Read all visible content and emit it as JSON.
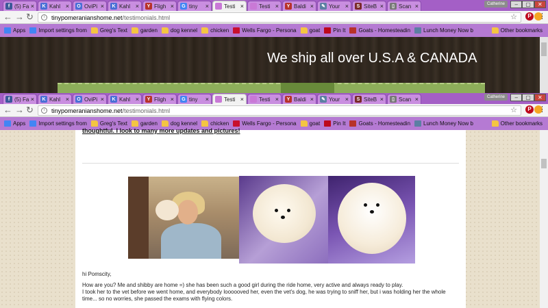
{
  "tabs": [
    {
      "title": "(5) Fa",
      "favicon_color": "#3b5998",
      "favicon_glyph": "f"
    },
    {
      "title": "Kahl",
      "favicon_color": "#4a6fd6",
      "favicon_glyph": "K"
    },
    {
      "title": "OviPi",
      "favicon_color": "#4a6fd6",
      "favicon_glyph": "O"
    },
    {
      "title": "Kahl",
      "favicon_color": "#4a6fd6",
      "favicon_glyph": "K"
    },
    {
      "title": "Fligh",
      "favicon_color": "#b7322a",
      "favicon_glyph": "Y"
    },
    {
      "title": "tiny",
      "favicon_color": "#4285f4",
      "favicon_glyph": "G"
    },
    {
      "title": "Testi",
      "favicon_color": "#c979d6",
      "favicon_glyph": ""
    },
    {
      "title": "Testi",
      "favicon_color": "#c979d6",
      "favicon_glyph": ""
    },
    {
      "title": "Baldi",
      "favicon_color": "#b7322a",
      "favicon_glyph": "Y"
    },
    {
      "title": "Your",
      "favicon_color": "#5c7fa3",
      "favicon_glyph": "✎"
    },
    {
      "title": "SiteB",
      "favicon_color": "#7a2a2a",
      "favicon_glyph": "S"
    },
    {
      "title": "Scan",
      "favicon_color": "#777777",
      "favicon_glyph": "▯"
    }
  ],
  "window_label": "Catherine",
  "address_bar": {
    "domain": "tinypomeranianshome.net",
    "path": "/testimonials.html"
  },
  "bookmarks": [
    {
      "label": "Apps",
      "icon": "apps-icon",
      "color": "#4285f4"
    },
    {
      "label": "Import settings from",
      "icon": "google-icon",
      "color": "#4285f4"
    },
    {
      "label": "Greg's Text",
      "icon": "folder-icon"
    },
    {
      "label": "garden",
      "icon": "folder-icon"
    },
    {
      "label": "dog kennel",
      "icon": "folder-icon"
    },
    {
      "label": "chicken",
      "icon": "folder-icon"
    },
    {
      "label": "Wells Fargo - Persona",
      "icon": "wellsfargo-icon",
      "color": "#c8102e"
    },
    {
      "label": "goat",
      "icon": "folder-icon"
    },
    {
      "label": "Pin It",
      "icon": "pinterest-icon",
      "color": "#bd081c"
    },
    {
      "label": "Goats - Homesteadin",
      "icon": "yelp-icon",
      "color": "#b7322a"
    },
    {
      "label": "Lunch Money Now b",
      "icon": "link-icon",
      "color": "#5c7fa3"
    }
  ],
  "other_bookmarks": "Other bookmarks",
  "hero": {
    "tagline": "We ship all over U.S.A & CANADA"
  },
  "content": {
    "previous_underlined": "thoughtful. I look to many more updates and pictures!",
    "greeting": "hi Pomscity,",
    "paragraph1": "How are you? Me and shibby are home =) she has been such a good girl during the ride home, very active and always ready to play.",
    "paragraph2": "I took her to the vet before we went home, and everybody loooooved her, even the vet's dog, he was trying to sniff her, but i was holding her the whole time... so no worries, she passed the exams with flying colors."
  },
  "colors": {
    "tab_bar": "#a45fc6",
    "bookmarks_bar": "#b57ad3",
    "hero_bg": "#2d251d",
    "stripe": "#8dae5a",
    "page_bg": "#e9e0cc"
  }
}
